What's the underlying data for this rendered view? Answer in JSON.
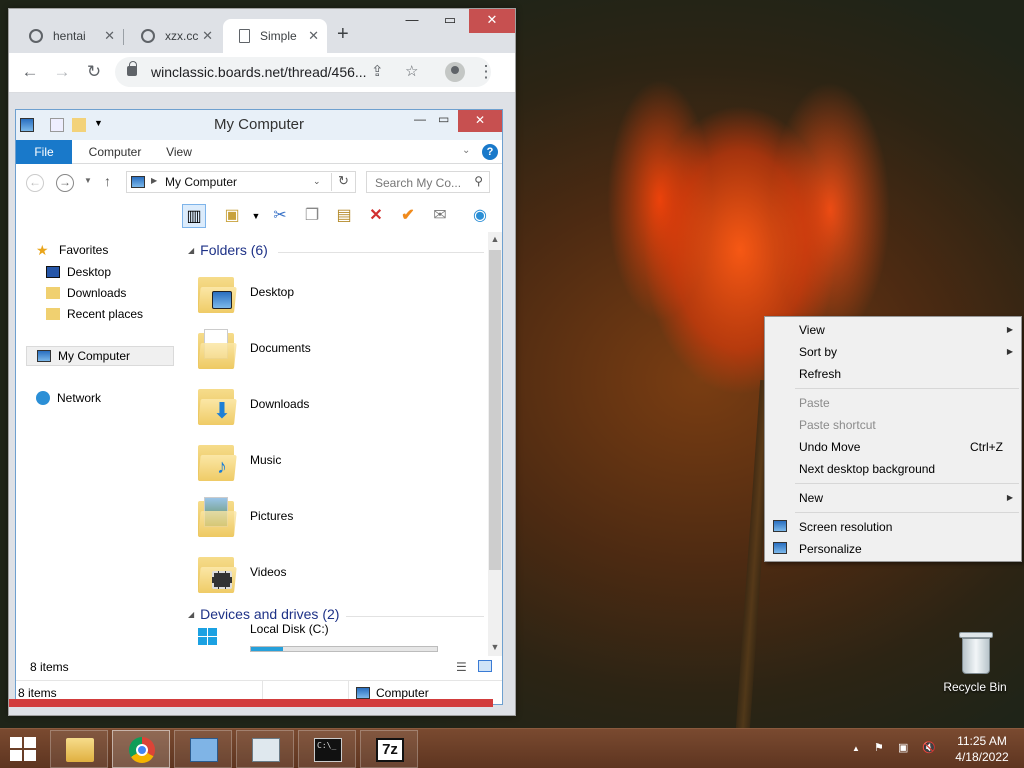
{
  "browser": {
    "tabs": [
      {
        "label": "hentai"
      },
      {
        "label": "xzx.cc"
      },
      {
        "label": "Simple"
      }
    ],
    "url": "winclassic.boards.net/thread/456..."
  },
  "explorer": {
    "title": "My Computer",
    "ribbon_tabs": [
      "File",
      "Computer",
      "View"
    ],
    "address": "My Computer",
    "search_placeholder": "Search My Co...",
    "nav": {
      "favorites": "Favorites",
      "desktop": "Desktop",
      "downloads": "Downloads",
      "recent": "Recent places",
      "my_computer": "My Computer",
      "network": "Network"
    },
    "folders_header": "Folders (6)",
    "folders": [
      "Desktop",
      "Documents",
      "Downloads",
      "Music",
      "Pictures",
      "Videos"
    ],
    "drives_header": "Devices and drives (2)",
    "drive": {
      "name": "Local Disk (C:)",
      "used_fraction": 0.17
    },
    "inner_status": "8 items",
    "outer_status_left": "8 items",
    "outer_status_right": "Computer"
  },
  "context_menu": {
    "items": [
      {
        "label": "View"
      },
      {
        "label": "Sort by"
      },
      {
        "label": "Refresh"
      },
      {
        "label": "Paste"
      },
      {
        "label": "Paste shortcut"
      },
      {
        "label": "Undo Move",
        "shortcut": "Ctrl+Z"
      },
      {
        "label": "Next desktop background"
      },
      {
        "label": "New"
      },
      {
        "label": "Screen resolution"
      },
      {
        "label": "Personalize"
      }
    ]
  },
  "desktop": {
    "recycle_bin": "Recycle Bin"
  },
  "taskbar": {
    "time": "11:25 AM",
    "date": "4/18/2022",
    "apps": [
      "file-explorer",
      "chrome",
      "control-panel",
      "task-manager",
      "command-prompt",
      "7-zip"
    ],
    "seven_zip_label": "7z"
  }
}
